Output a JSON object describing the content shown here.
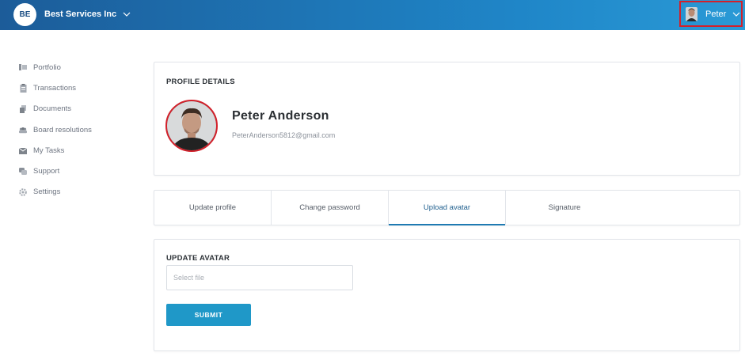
{
  "header": {
    "company_initials": "BE",
    "company_name": "Best Services Inc",
    "user_name": "Peter"
  },
  "sidebar": {
    "items": [
      {
        "label": "Portfolio",
        "icon": "portfolio-icon"
      },
      {
        "label": "Transactions",
        "icon": "transactions-icon"
      },
      {
        "label": "Documents",
        "icon": "documents-icon"
      },
      {
        "label": "Board resolutions",
        "icon": "board-resolutions-icon"
      },
      {
        "label": "My Tasks",
        "icon": "tasks-icon"
      },
      {
        "label": "Support",
        "icon": "support-icon"
      },
      {
        "label": "Settings",
        "icon": "settings-icon"
      }
    ]
  },
  "profile": {
    "section_title": "PROFILE DETAILS",
    "full_name": "Peter Anderson",
    "email": "PeterAnderson5812@gmail.com"
  },
  "tabs": [
    {
      "label": "Update profile",
      "active": false
    },
    {
      "label": "Change password",
      "active": false
    },
    {
      "label": "Upload avatar",
      "active": true
    },
    {
      "label": "Signature",
      "active": false
    }
  ],
  "upload_avatar": {
    "section_title": "UPDATE AVATAR",
    "file_placeholder": "Select file",
    "submit_label": "SUBMIT"
  },
  "colors": {
    "header_start": "#1c5c99",
    "header_end": "#2a9ad6",
    "accent": "#1f98c8",
    "highlight_border": "#d3202a"
  }
}
